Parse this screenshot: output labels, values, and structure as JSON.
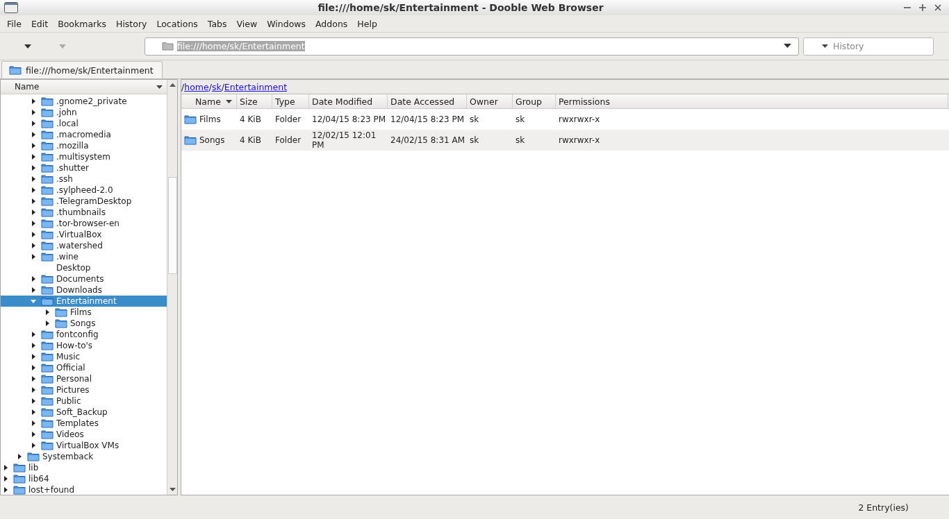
{
  "window": {
    "title": "file:///home/sk/Entertainment - Dooble Web Browser"
  },
  "menu": [
    {
      "label": "File"
    },
    {
      "label": "Edit"
    },
    {
      "label": "Bookmarks"
    },
    {
      "label": "History"
    },
    {
      "label": "Locations"
    },
    {
      "label": "Tabs"
    },
    {
      "label": "View"
    },
    {
      "label": "Windows"
    },
    {
      "label": "Addons"
    },
    {
      "label": "Help"
    }
  ],
  "toolbar": {
    "back_enabled": true,
    "forward_enabled": false
  },
  "address": {
    "value": "file:///home/sk/Entertainment"
  },
  "history": {
    "placeholder": "History"
  },
  "tabs": [
    {
      "label": "file:///home/sk/Entertainment",
      "selected": true
    }
  ],
  "tree": {
    "header": "Name",
    "items": [
      {
        "children": [
          {
            "children": [
              {
                "label": ".gnome2_private",
                "kind": "folder",
                "selected": false
              },
              {
                "label": ".john",
                "kind": "folder",
                "selected": false
              },
              {
                "label": ".local",
                "kind": "folder",
                "selected": false
              },
              {
                "label": ".macromedia",
                "kind": "folder",
                "selected": false
              },
              {
                "label": ".mozilla",
                "kind": "folder",
                "selected": false
              },
              {
                "label": ".multisystem",
                "kind": "folder",
                "selected": false
              },
              {
                "label": ".shutter",
                "kind": "folder",
                "selected": false
              },
              {
                "label": ".ssh",
                "kind": "folder",
                "selected": false
              },
              {
                "label": ".sylpheed-2.0",
                "kind": "folder",
                "selected": false
              },
              {
                "label": ".TelegramDesktop",
                "kind": "folder",
                "selected": false
              },
              {
                "label": ".thumbnails",
                "kind": "folder",
                "selected": false
              },
              {
                "label": ".tor-browser-en",
                "kind": "folder",
                "selected": false
              },
              {
                "label": ".VirtualBox",
                "kind": "folder",
                "selected": false
              },
              {
                "label": ".watershed",
                "kind": "folder",
                "selected": false
              },
              {
                "label": ".wine",
                "kind": "folder",
                "selected": false
              },
              {
                "label": "Desktop",
                "kind": "plain",
                "selected": false
              },
              {
                "label": "Documents",
                "kind": "folder",
                "selected": false
              },
              {
                "label": "Downloads",
                "kind": "folder",
                "selected": false
              },
              {
                "label": "Entertainment",
                "kind": "folder",
                "selected": true,
                "children": [
                  {
                    "label": "Films",
                    "kind": "folder",
                    "selected": false
                  },
                  {
                    "label": "Songs",
                    "kind": "folder",
                    "selected": false
                  }
                ]
              },
              {
                "label": "fontconfig",
                "kind": "folder",
                "selected": false
              },
              {
                "label": "How-to's",
                "kind": "folder",
                "selected": false
              },
              {
                "label": "Music",
                "kind": "folder",
                "selected": false
              },
              {
                "label": "Official",
                "kind": "folder",
                "selected": false
              },
              {
                "label": "Personal",
                "kind": "folder",
                "selected": false
              },
              {
                "label": "Pictures",
                "kind": "folder",
                "selected": false
              },
              {
                "label": "Public",
                "kind": "folder",
                "selected": false
              },
              {
                "label": "Soft_Backup",
                "kind": "folder",
                "selected": false
              },
              {
                "label": "Templates",
                "kind": "folder",
                "selected": false
              },
              {
                "label": "Videos",
                "kind": "folder",
                "selected": false
              },
              {
                "label": "VirtualBox VMs",
                "kind": "folder",
                "selected": false
              }
            ]
          },
          {
            "label": "Systemback",
            "kind": "folder",
            "selected": false
          }
        ]
      },
      {
        "label": "lib",
        "kind": "folder",
        "selected": false
      },
      {
        "label": "lib64",
        "kind": "folder",
        "selected": false
      },
      {
        "label": "lost+found",
        "kind": "folder",
        "selected": false
      }
    ]
  },
  "breadcrumb": [
    {
      "kind": "separator",
      "label": "/"
    },
    {
      "kind": "link",
      "label": "home"
    },
    {
      "kind": "separator",
      "label": "/"
    },
    {
      "kind": "link",
      "label": "sk"
    },
    {
      "kind": "separator",
      "label": "/"
    },
    {
      "kind": "link",
      "label": "Entertainment"
    }
  ],
  "table": {
    "columns": [
      "Name",
      "Size",
      "Type",
      "Date Modified",
      "Date Accessed",
      "Owner",
      "Group",
      "Permissions"
    ],
    "rows": [
      [
        "Films",
        "4 KiB",
        "Folder",
        "12/04/15 8:23 PM",
        "12/04/15 8:23 PM",
        "sk",
        "sk",
        "rwxrwxr-x"
      ],
      [
        "Songs",
        "4 KiB",
        "Folder",
        "12/02/15 12:01 PM",
        "24/02/15 8:31 AM",
        "sk",
        "sk",
        "rwxrwxr-x"
      ]
    ]
  },
  "status_bar": {
    "text": "2 Entry(ies)"
  }
}
